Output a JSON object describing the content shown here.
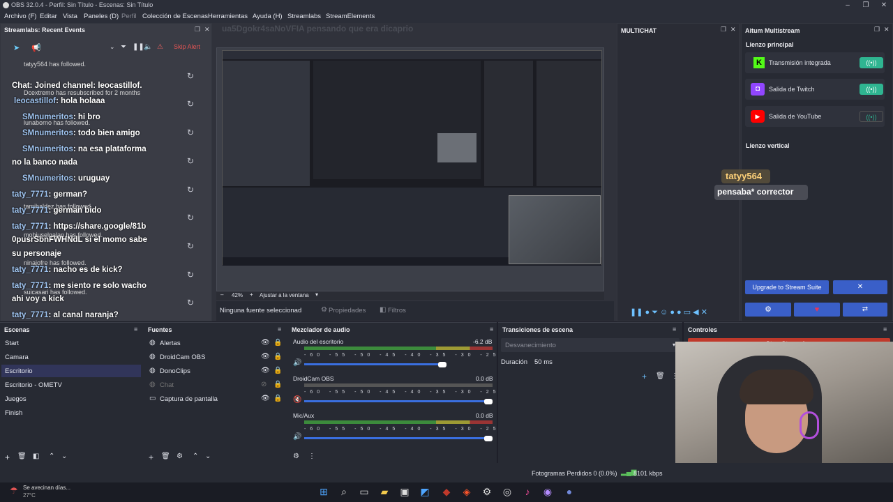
{
  "title": "OBS 32.0.4 - Perfil: Sin Título - Escenas: Sin Título",
  "menu": [
    "Archivo (F)",
    "Editar",
    "Vista",
    "Paneles (D)",
    "Perfil",
    "Colección de Escenas",
    "Herramientas",
    "Ayuda (H)",
    "Streamlabs",
    "StreamElements"
  ],
  "events": {
    "title": "Streamlabs: Recent Events",
    "skip": "Skip Alert",
    "overlay": "ua5Dgokr4saNoVFIA pensando que era dicaprio",
    "items": [
      {
        "small": "tatyy564 has followed."
      },
      {
        "chat": "Chat: Joined channel: leocastillof."
      },
      {
        "small": "Dcextremo has resubscribed for 2 months"
      },
      {
        "user": "leocastillof",
        "msg": ": hola holaaa"
      },
      {
        "user": "SMnumeritos",
        "msg": ": hi bro"
      },
      {
        "small": "lunaborno has followed."
      },
      {
        "user": "SMnumeritos",
        "msg": ": todo bien amigo"
      },
      {
        "user": "SMnumeritos",
        "msg": ": na esa plataforma"
      },
      {
        "chat": "no la banco nada"
      },
      {
        "user": "SMnumeritos",
        "msg": ": uruguay"
      },
      {
        "user": "taty_7771",
        "msg": ": german?"
      },
      {
        "small": "tamihaldez has followed."
      },
      {
        "user": "taty_7771",
        "msg": ": german bido"
      },
      {
        "user": "taty_7771",
        "msg": ": https://share.google/81b"
      },
      {
        "chat": "0pusrSbnFWHNdL si el momo sabe"
      },
      {
        "small": "mobiuselgalan has followed."
      },
      {
        "chat": "su personaje"
      },
      {
        "small": "ninajofre has followed."
      },
      {
        "user": "taty_7771",
        "msg": ": nacho es de kick?"
      },
      {
        "user": "taty_7771",
        "msg": ": me siento re solo wacho"
      },
      {
        "small": "suicasari has followed."
      },
      {
        "chat": "ahi voy a kick"
      },
      {
        "user": "taty_7771",
        "msg": ": al canal naranja?"
      }
    ]
  },
  "preview": {
    "zoom": "42%",
    "fit": "Ajustar a la ventana",
    "no_source": "Ninguna fuente seleccionad",
    "props": "Propiedades",
    "filters": "Filtros"
  },
  "multichat": {
    "title": "MULTICHAT"
  },
  "aitum": {
    "title": "Aitum Multistream",
    "main": "Lienzo principal",
    "vertical": "Lienzo vertical",
    "outputs": [
      "Transmisión integrada",
      "Salida de Twitch",
      "Salida de YouTube"
    ],
    "upgrade": "Upgrade to Stream Suite"
  },
  "alert": {
    "user": "tatyy564",
    "msg": "pensaba* corrector"
  },
  "scenes": {
    "title": "Escenas",
    "items": [
      "Start",
      "Camara",
      "Escritorio",
      "Escritorio - OMETV",
      "Juegos",
      "Finish"
    ]
  },
  "sources": {
    "title": "Fuentes",
    "items": [
      "Alertas",
      "DroidCam OBS",
      "DonoClips",
      "Chat",
      "Captura de pantalla"
    ]
  },
  "mixer": {
    "title": "Mezclador de audio",
    "scale": "-60 -55 -50 -45 -40 -35 -30 -25 -20 -15 -10 -5 0",
    "channels": [
      {
        "name": "Audio del escritorio",
        "db": "-6.2 dB"
      },
      {
        "name": "DroidCam OBS",
        "db": "0.0 dB"
      },
      {
        "name": "Mic/Aux",
        "db": "0.0 dB"
      }
    ]
  },
  "transitions": {
    "title": "Transiciones de escena",
    "type": "Desvanecimiento",
    "dur_label": "Duración",
    "dur": "50 ms"
  },
  "controls": {
    "title": "Controles",
    "stop": "Stop Streaming"
  },
  "status": {
    "frames": "Fotogramas Perdidos 0 (0.0%)",
    "kbps": "8101 kbps"
  },
  "weather": {
    "text": "Se avecinan días...",
    "temp": "27°C"
  },
  "colors": {
    "accent": "#2fb591",
    "upgrade": "#3a5fc8",
    "stop": "#c0392b"
  }
}
